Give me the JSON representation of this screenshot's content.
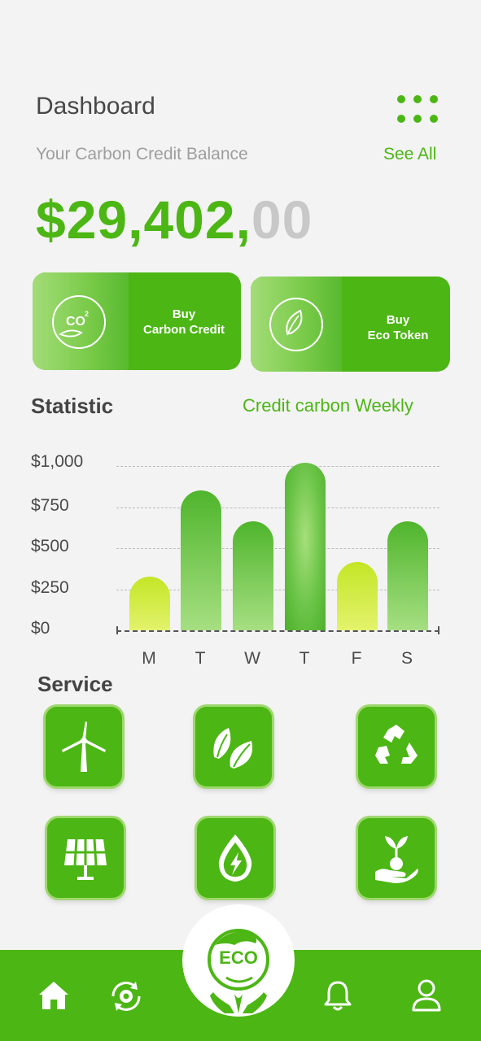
{
  "header": {
    "title": "Dashboard"
  },
  "balance": {
    "label": "Your Carbon Credit Balance",
    "see_all": "See All",
    "amount_main": "$29,402,",
    "amount_cents": "00"
  },
  "actions": [
    {
      "label_line1": "Buy",
      "label_line2": "Carbon Credit",
      "icon": "co2-icon"
    },
    {
      "label_line1": "Buy",
      "label_line2": "Eco Token",
      "icon": "leaf-icon"
    }
  ],
  "statistic": {
    "title": "Statistic",
    "subtitle": "Credit carbon Weekly"
  },
  "chart_data": {
    "type": "bar",
    "categories": [
      "M",
      "T",
      "W",
      "T",
      "F",
      "S"
    ],
    "values": [
      325,
      850,
      665,
      1020,
      415,
      665
    ],
    "y_tick_labels": [
      "$1,000",
      "$750",
      "$500",
      "$250",
      "$0"
    ],
    "ylim": [
      0,
      1000
    ],
    "grid": true,
    "colors": [
      "#d4ec44",
      "#5dbd38",
      "#5dbd38",
      "#4cb02a",
      "#d4ec44",
      "#5dbd38"
    ]
  },
  "service": {
    "title": "Service",
    "items": [
      {
        "icon": "wind-turbine-icon"
      },
      {
        "icon": "leaves-icon"
      },
      {
        "icon": "recycle-icon"
      },
      {
        "icon": "solar-panel-icon"
      },
      {
        "icon": "water-energy-icon"
      },
      {
        "icon": "plant-in-hand-icon"
      }
    ]
  },
  "bottom_nav": {
    "center_logo": "ECO",
    "items": [
      {
        "icon": "home-icon"
      },
      {
        "icon": "settings-sync-icon"
      },
      {
        "icon": "bell-icon"
      },
      {
        "icon": "user-icon"
      }
    ]
  },
  "colors": {
    "accent": "#4cb614",
    "background": "#f3f3f3",
    "muted": "#c8c8c8"
  }
}
